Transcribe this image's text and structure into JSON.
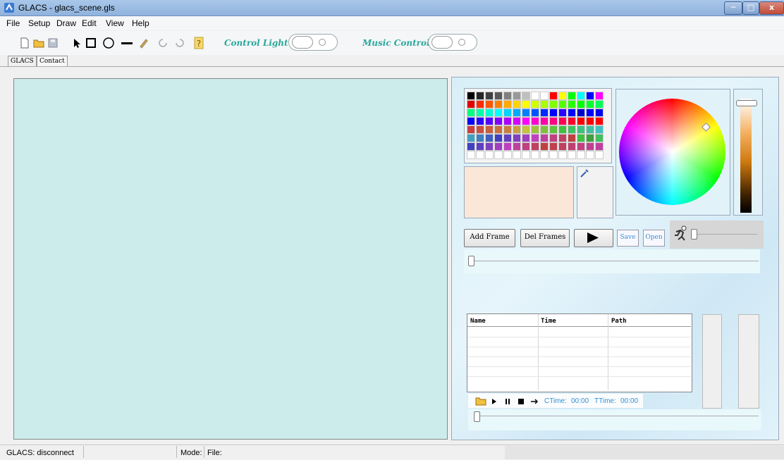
{
  "window": {
    "title": "GLACS - glacs_scene.gls",
    "controls": [
      "─",
      "□",
      "x"
    ]
  },
  "menu": [
    "File",
    "Setup",
    "Draw",
    "Edit",
    "View",
    "Help"
  ],
  "toolbar": {
    "icons": [
      "new-file-icon",
      "open-folder-icon",
      "save-icon",
      "pointer-icon",
      "rectangle-icon",
      "ellipse-icon",
      "line-icon",
      "pencil-icon",
      "undo-icon",
      "redo-icon",
      "help-icon"
    ],
    "control_light_label": "Control Light",
    "music_control_label": "Music Control",
    "control_light_on": false,
    "music_control_on": false
  },
  "tabs": [
    "GLACS",
    "Contact"
  ],
  "colors": {
    "canvas": "#cbeceb",
    "preview": "#fbe7d8",
    "accent": "#2aa89a",
    "link": "#2f8fd8"
  },
  "palette_rows": [
    [
      "#000000",
      "#262626",
      "#404040",
      "#595959",
      "#808080",
      "#999999",
      "#bfbfbf",
      "#ffffff",
      "#ffffff",
      "#ff0000",
      "#ffff00",
      "#00ff00",
      "#00ffff",
      "#0000ff",
      "#ff00ff"
    ],
    [
      "#e00000",
      "#ff2a00",
      "#ff5500",
      "#ff8000",
      "#ffaa00",
      "#ffd400",
      "#ffff00",
      "#d4ff00",
      "#aaff00",
      "#80ff00",
      "#55ff00",
      "#2aff00",
      "#00ff00",
      "#00ff2a",
      "#00ff55"
    ],
    [
      "#00ff80",
      "#00ffaa",
      "#00ffd4",
      "#00ffff",
      "#00d4ff",
      "#00aaff",
      "#0080ff",
      "#0055ff",
      "#002aff",
      "#0000ff",
      "#2a00ff",
      "#0000ff",
      "#0000cc",
      "#0000ff",
      "#0000ee"
    ],
    [
      "#0000ff",
      "#2a00ff",
      "#5500ff",
      "#8000ff",
      "#aa00ff",
      "#d400ff",
      "#ff00ff",
      "#ff00d4",
      "#ff00aa",
      "#ff0080",
      "#ff0055",
      "#ff002a",
      "#ff0000",
      "#ff0000",
      "#ff0000"
    ],
    [
      "#c84040",
      "#c85040",
      "#c86040",
      "#c87040",
      "#c88040",
      "#c8a040",
      "#c8c040",
      "#a0c040",
      "#80c040",
      "#60c040",
      "#40c040",
      "#40c060",
      "#40c080",
      "#40c0a0",
      "#40c0c0"
    ],
    [
      "#40a0c0",
      "#4080c0",
      "#4060c0",
      "#4040c0",
      "#6040c0",
      "#8040c0",
      "#a040c0",
      "#c040c0",
      "#c040a0",
      "#c04080",
      "#c04060",
      "#c04040",
      "#40c040",
      "#40a040",
      "#40c060"
    ],
    [
      "#4040c0",
      "#6040c0",
      "#8040c0",
      "#a040c0",
      "#c040c0",
      "#c040a0",
      "#c04080",
      "#c04060",
      "#c04040",
      "#c04050",
      "#c04060",
      "#c04070",
      "#c04080",
      "#c04090",
      "#c040a0"
    ],
    [
      "#ffffff",
      "#ffffff",
      "#ffffff",
      "#ffffff",
      "#ffffff",
      "#ffffff",
      "#ffffff",
      "#ffffff",
      "#ffffff",
      "#ffffff",
      "#ffffff",
      "#ffffff",
      "#ffffff",
      "#ffffff",
      "#ffffff"
    ]
  ],
  "frames": {
    "add_label": "Add Frame",
    "del_label": "Del Frames",
    "save_label": "Save",
    "open_label": "Open",
    "play_icon": "play-icon",
    "speed_icon": "running-man-icon",
    "speed_level": 0,
    "frame_position": 0
  },
  "music": {
    "columns": [
      "Name",
      "Time",
      "Path"
    ],
    "rows": [],
    "ctime_label": "CTime:",
    "ctime": "00:00",
    "ttime_label": "TTime:",
    "ttime": "00:00",
    "position": 0
  },
  "status": {
    "connection": "GLACS: disconnect",
    "mode_label": "Mode:",
    "file_label": "File:"
  }
}
